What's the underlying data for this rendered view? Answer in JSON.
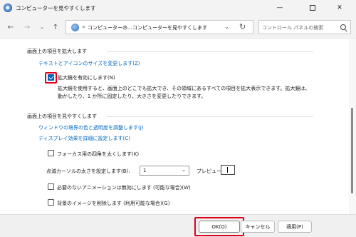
{
  "window": {
    "title": "コンピューターを見やすくします",
    "minimize_glyph": "—",
    "close_glyph": "✕"
  },
  "nav": {
    "back_glyph": "←",
    "forward_glyph": "→",
    "recent_glyph": "⌄",
    "up_glyph": "↑",
    "address_sep": "«",
    "breadcrumb_1": "コンピューターの...",
    "breadcrumb_sep": "›",
    "breadcrumb_2": "コンピューターを見やすくします",
    "dropdown_glyph": "⌄",
    "refresh_glyph": "↻",
    "search_placeholder": "コントロール パネルの検索"
  },
  "section_magnify": {
    "heading": "画面上の項目を拡大します",
    "link_text_size": "テキストとアイコンのサイズを変更します(Z)",
    "magnifier_checkbox_label": "拡大鏡を有効にします(N)",
    "magnifier_checked": true,
    "description_line1": "拡大鏡を使用すると、画面上のどこでも拡大でき、その領域にあるすべての項目を拡大表示できます。拡大鏡は、",
    "description_line2": "動かしたり、1 か所に固定したり、大きさを変更したりできます。"
  },
  "section_visibility": {
    "heading": "画面上の項目を見やすくします",
    "link_border_color": "ウィンドウの境界の色と透明度を調整します(J)",
    "link_display_effects": "ディスプレイ効果を詳細に設定します(C)",
    "focus_rectangle_label": "フォーカス用の四角を太くします(K)",
    "focus_rectangle_checked": false,
    "cursor_thickness_label": "点滅カーソルの太さを設定します(B):",
    "cursor_thickness_value": "1",
    "select_arrow_glyph": "⌄",
    "preview_label": "プレビュー:",
    "animations_label": "必要のないアニメーションは無効にします (可能な場合)(W)",
    "animations_checked": false,
    "background_label": "背景のイメージを削除します (利用可能な場合)(G)",
    "background_checked": false
  },
  "footer": {
    "ok_label": "OK(O)",
    "cancel_label": "キャンセル",
    "apply_label": "適用(P)"
  },
  "colors": {
    "highlight_red": "#e0001b",
    "link_blue": "#0067c0",
    "checkbox_blue": "#005fb8"
  }
}
